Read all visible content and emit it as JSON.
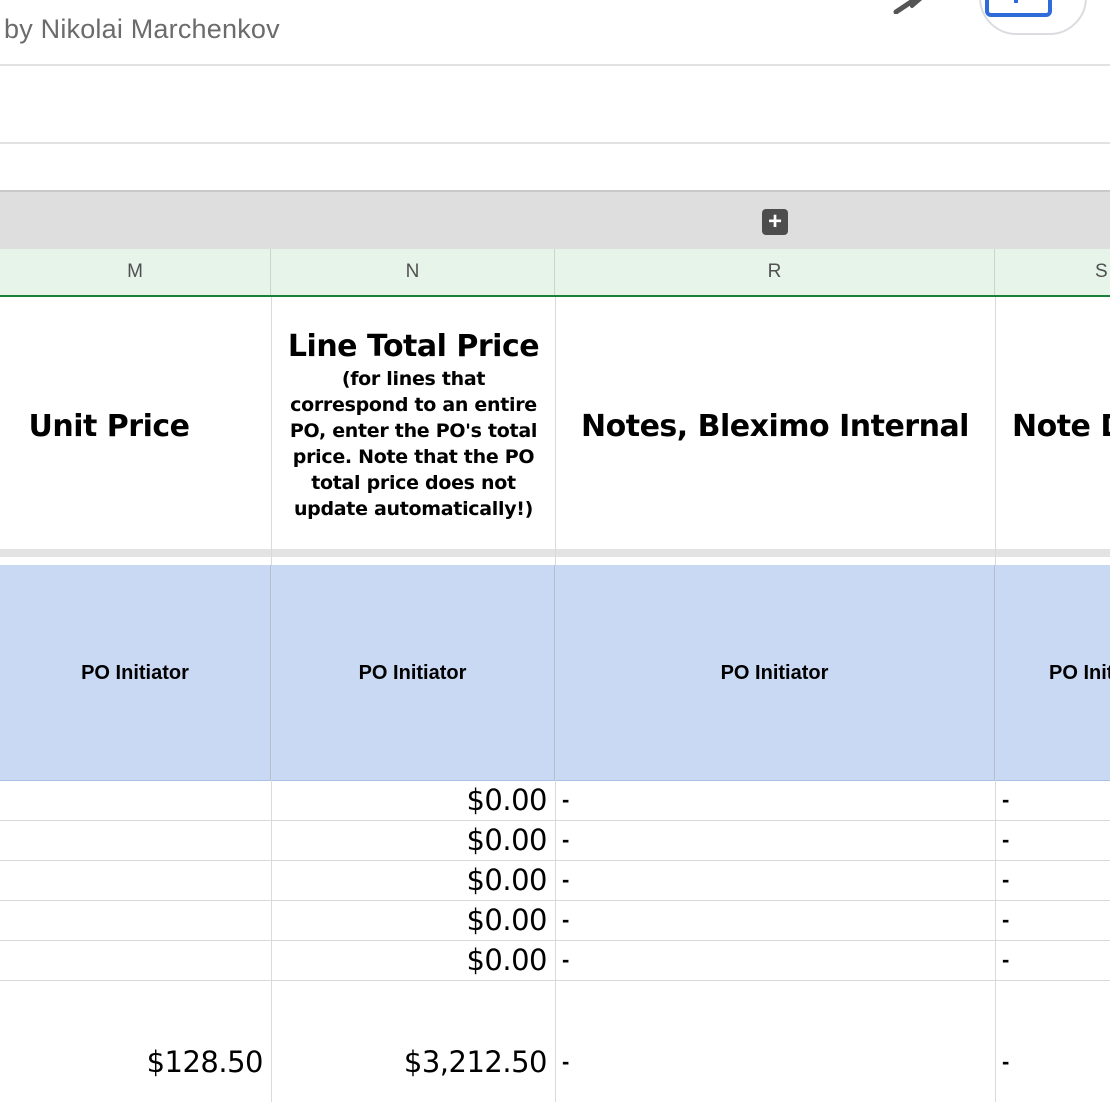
{
  "header": {
    "author": "by Nikolai Marchenkov"
  },
  "icons": {
    "edit": "pen-icon",
    "share": "share-icon",
    "expand": "plus-icon"
  },
  "columns": [
    {
      "letter": "M"
    },
    {
      "letter": "N"
    },
    {
      "letter": "R"
    },
    {
      "letter": "S"
    }
  ],
  "headers": {
    "unit_price": "Unit Price",
    "line_total_title": "Line Total Price",
    "line_total_note": "(for lines that correspond to an entire PO, enter the PO's total price. Note that the PO total price does not update automatically!)",
    "notes_internal": "Notes, Bleximo Internal",
    "note_d": "Note D"
  },
  "roles": [
    "PO Initiator",
    "PO Initiator",
    "PO Initiator",
    "PO Init"
  ],
  "rows": [
    {
      "unit_price": "",
      "line_total": "$0.00",
      "notes": "-",
      "note_d": "-"
    },
    {
      "unit_price": "",
      "line_total": "$0.00",
      "notes": "-",
      "note_d": "-"
    },
    {
      "unit_price": "",
      "line_total": "$0.00",
      "notes": "-",
      "note_d": "-"
    },
    {
      "unit_price": "",
      "line_total": "$0.00",
      "notes": "-",
      "note_d": "-"
    },
    {
      "unit_price": "",
      "line_total": "$0.00",
      "notes": "-",
      "note_d": "-"
    },
    {
      "unit_price": "$128.50",
      "line_total": "$3,212.50",
      "notes": "-",
      "note_d": "-"
    }
  ],
  "colors": {
    "header_bg": "#e6f4ea",
    "header_border": "#188038",
    "role_bg": "#c9d9f3",
    "share_blue": "#2f6bd9"
  }
}
